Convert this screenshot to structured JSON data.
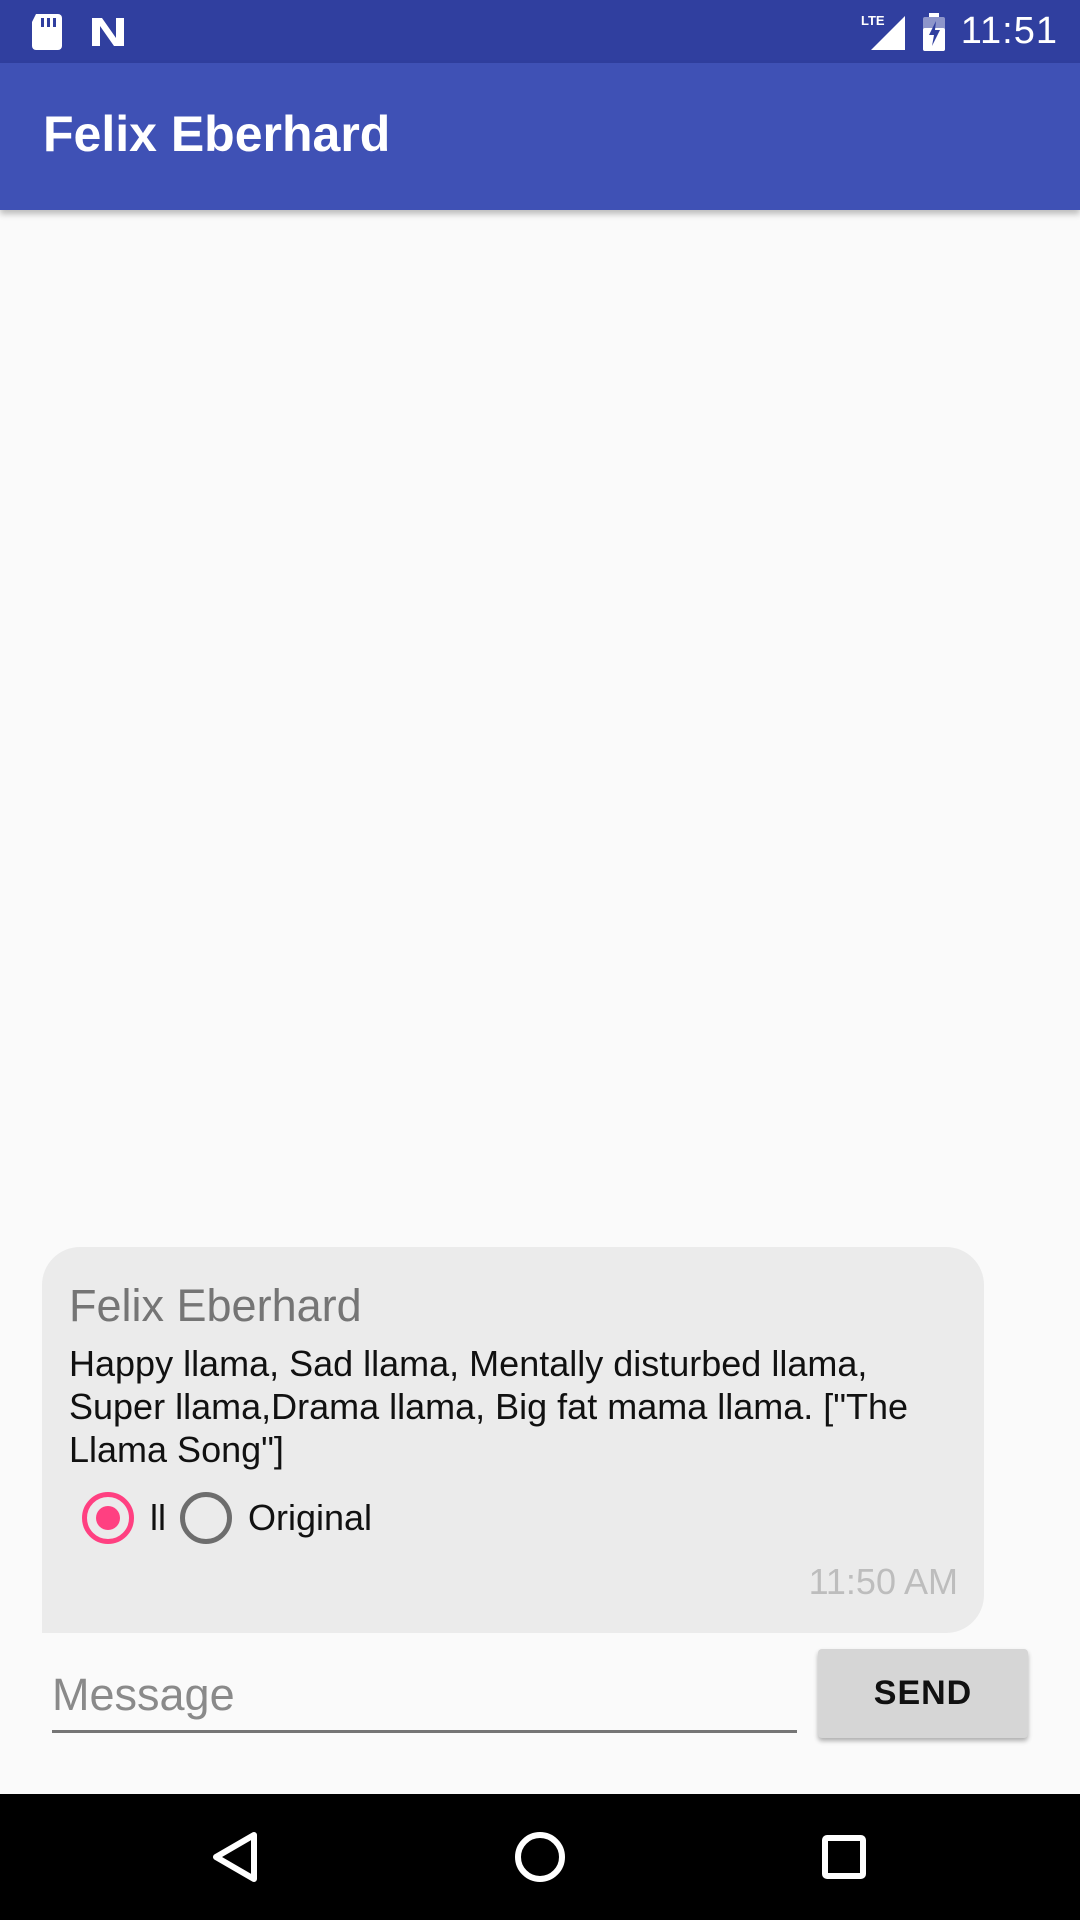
{
  "status_bar": {
    "time": "11:51",
    "icons": [
      "sd-card-icon",
      "n-app-icon",
      "lte-signal-icon",
      "battery-charging-icon"
    ]
  },
  "app_bar": {
    "title": "Felix Eberhard"
  },
  "message": {
    "sender": "Felix Eberhard",
    "text": "Happy llama, Sad llama, Mentally disturbed llama, Super llama,Drama llama, Big fat mama llama. [\"The Llama Song\"]",
    "options": [
      {
        "label": "ll",
        "selected": true
      },
      {
        "label": "Original",
        "selected": false
      }
    ],
    "time": "11:50 AM"
  },
  "composer": {
    "placeholder": "Message",
    "value": "",
    "send_label": "SEND"
  },
  "nav_bar": {
    "buttons": [
      "back-icon",
      "home-icon",
      "recents-icon"
    ]
  },
  "colors": {
    "status_bar": "#303f9f",
    "primary": "#3f51b5",
    "accent": "#ff4081",
    "bubble": "#ebebeb"
  }
}
